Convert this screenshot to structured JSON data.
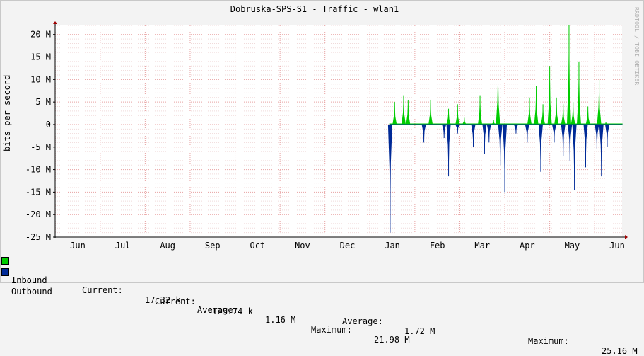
{
  "chart_data": {
    "type": "area",
    "title": "Dobruska-SPS-S1 - Traffic - wlan1",
    "watermark": "RRDTOOL / TOBI OETIKER",
    "ylabel": "bits per second",
    "ylim": [
      -25000000,
      22000000
    ],
    "y_ticks": [
      {
        "value": 20000000,
        "label": "20 M"
      },
      {
        "value": 15000000,
        "label": "15 M"
      },
      {
        "value": 10000000,
        "label": "10 M"
      },
      {
        "value": 5000000,
        "label": "5 M"
      },
      {
        "value": 0,
        "label": "0"
      },
      {
        "value": -5000000,
        "label": "-5 M"
      },
      {
        "value": -10000000,
        "label": "-10 M"
      },
      {
        "value": -15000000,
        "label": "-15 M"
      },
      {
        "value": -20000000,
        "label": "-20 M"
      },
      {
        "value": -25000000,
        "label": "-25 M"
      }
    ],
    "x_ticks": [
      "Jun",
      "Jul",
      "Aug",
      "Sep",
      "Oct",
      "Nov",
      "Dec",
      "Jan",
      "Feb",
      "Mar",
      "Apr",
      "May",
      "Jun"
    ],
    "grid": true,
    "colors": {
      "inbound": "#00cc00",
      "outbound": "#002a97",
      "grid": "#e8a0a0",
      "background": "#ffffff"
    },
    "series": [
      {
        "name": "Inbound",
        "direction": "positive",
        "peaks": [
          {
            "x": 7.05,
            "value": 5000000
          },
          {
            "x": 7.25,
            "value": 6500000
          },
          {
            "x": 7.35,
            "value": 5500000
          },
          {
            "x": 7.85,
            "value": 5500000
          },
          {
            "x": 8.25,
            "value": 3500000
          },
          {
            "x": 8.45,
            "value": 4500000
          },
          {
            "x": 8.6,
            "value": 1500000
          },
          {
            "x": 8.95,
            "value": 6500000
          },
          {
            "x": 9.25,
            "value": 1000000
          },
          {
            "x": 9.35,
            "value": 12500000
          },
          {
            "x": 10.05,
            "value": 6000000
          },
          {
            "x": 10.2,
            "value": 8500000
          },
          {
            "x": 10.35,
            "value": 4500000
          },
          {
            "x": 10.5,
            "value": 13000000
          },
          {
            "x": 10.65,
            "value": 6000000
          },
          {
            "x": 10.8,
            "value": 4500000
          },
          {
            "x": 10.93,
            "value": 22000000
          },
          {
            "x": 11.02,
            "value": 5000000
          },
          {
            "x": 11.15,
            "value": 14000000
          },
          {
            "x": 11.35,
            "value": 4000000
          },
          {
            "x": 11.6,
            "value": 10000000
          },
          {
            "x": 11.75,
            "value": 500000
          }
        ]
      },
      {
        "name": "Outbound",
        "direction": "negative",
        "peaks": [
          {
            "x": 6.95,
            "value": 24000000
          },
          {
            "x": 7.7,
            "value": 4000000
          },
          {
            "x": 8.15,
            "value": 3000000
          },
          {
            "x": 8.25,
            "value": 11500000
          },
          {
            "x": 8.45,
            "value": 2000000
          },
          {
            "x": 8.8,
            "value": 5000000
          },
          {
            "x": 9.05,
            "value": 6500000
          },
          {
            "x": 9.15,
            "value": 4000000
          },
          {
            "x": 9.4,
            "value": 9000000
          },
          {
            "x": 9.5,
            "value": 15000000
          },
          {
            "x": 9.75,
            "value": 2000000
          },
          {
            "x": 10.0,
            "value": 4000000
          },
          {
            "x": 10.3,
            "value": 10500000
          },
          {
            "x": 10.6,
            "value": 4000000
          },
          {
            "x": 10.8,
            "value": 7000000
          },
          {
            "x": 10.95,
            "value": 8000000
          },
          {
            "x": 11.05,
            "value": 14500000
          },
          {
            "x": 11.3,
            "value": 9500000
          },
          {
            "x": 11.55,
            "value": 5500000
          },
          {
            "x": 11.65,
            "value": 11500000
          },
          {
            "x": 11.78,
            "value": 5000000
          }
        ]
      }
    ]
  },
  "legend": {
    "inbound": {
      "label": "Inbound",
      "current_label": "Current:",
      "current": "17.32 k",
      "average_label": "Average:",
      "average": "1.16 M",
      "maximum_label": "Maximum:",
      "maximum": "21.98 M"
    },
    "outbound": {
      "label": "Outbound",
      "current_label": "Current:",
      "current": "123.74 k",
      "average_label": "Average:",
      "average": "1.72 M",
      "maximum_label": "Maximum:",
      "maximum": "25.16 M"
    }
  }
}
